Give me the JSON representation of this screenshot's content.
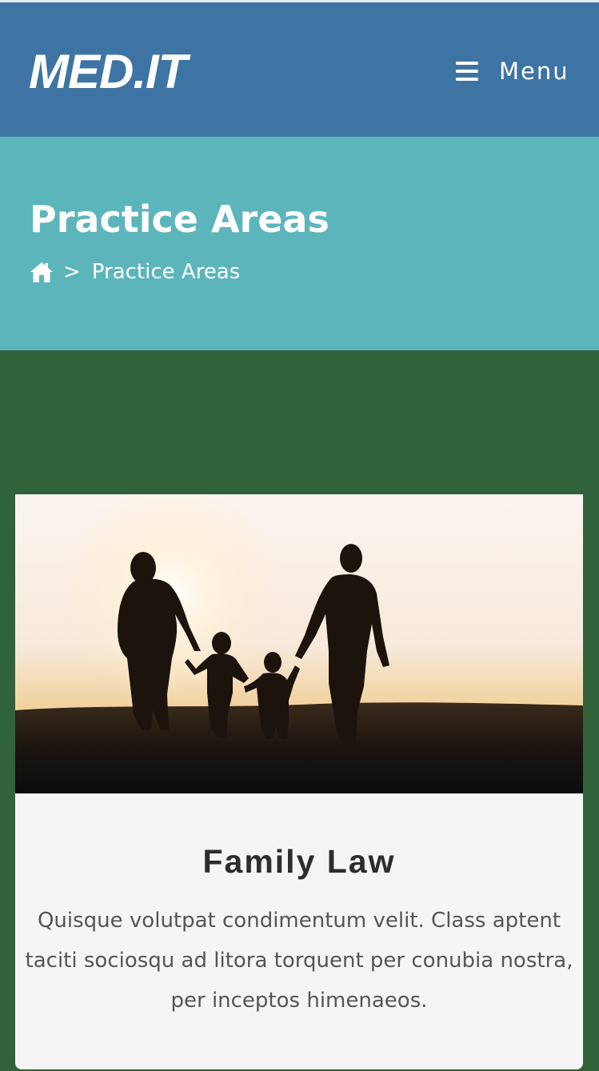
{
  "header": {
    "logo_text": "MED.IT",
    "menu_label": "Menu",
    "background_color": "#3e74a3"
  },
  "hero": {
    "title": "Practice Areas",
    "breadcrumb": {
      "home_icon": "home-icon",
      "separator": ">",
      "current": "Practice Areas"
    },
    "background_color": "#5db5bc"
  },
  "main": {
    "background_color": "#306339",
    "card": {
      "title": "Family Law",
      "description": "Quisque volutpat condimentum velit. Class aptent taciti sociosqu ad litora torquent per conubia nostra, per inceptos himenaeos."
    }
  }
}
